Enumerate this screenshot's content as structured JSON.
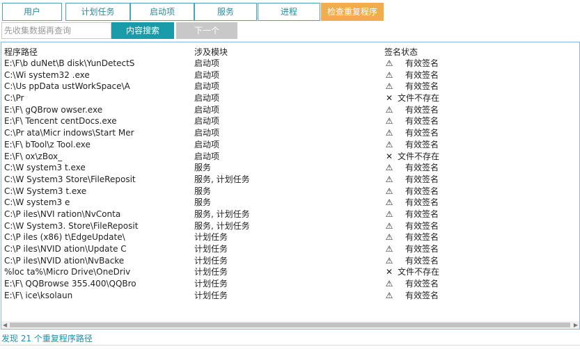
{
  "tabs": [
    {
      "label": "用户"
    },
    {
      "label": "计划任务"
    },
    {
      "label": "启动项"
    },
    {
      "label": "服务"
    },
    {
      "label": "进程"
    },
    {
      "label": "检查重复程序",
      "active": true
    }
  ],
  "toolbar": {
    "search_placeholder": "先收集数据再查询",
    "search_value": "",
    "search_button": "内容搜索",
    "next_button": "下一个"
  },
  "table": {
    "columns": [
      "程序路径",
      "涉及模块",
      "签名状态"
    ],
    "rows": [
      {
        "path": "E:\\F\\b        duNet\\B          disk\\YunDetectS",
        "module": "启动项",
        "sig_icon": "warning-icon",
        "sig": "有效签名"
      },
      {
        "path": "C:\\Wi         system32        .exe",
        "module": "启动项",
        "sig_icon": "warning-icon",
        "sig": "有效签名"
      },
      {
        "path": "C:\\Us        ppData          ustWorkSpace\\A",
        "module": "启动项",
        "sig_icon": "warning-icon",
        "sig": "有效签名"
      },
      {
        "path": "C:\\Pr",
        "module": "启动项",
        "sig_icon": "cross-icon",
        "sig": "文件不存在"
      },
      {
        "path": "E:\\F\\         gQBrow          owser.exe",
        "module": "启动项",
        "sig_icon": "warning-icon",
        "sig": "有效签名"
      },
      {
        "path": "E:\\F\\         Tencent         centDocs.exe",
        "module": "启动项",
        "sig_icon": "warning-icon",
        "sig": "有效签名"
      },
      {
        "path": "C:\\Pr         ata\\Micr        indows\\Start Mer",
        "module": "启动项",
        "sig_icon": "warning-icon",
        "sig": "有效签名"
      },
      {
        "path": "E:\\F\\         bTool\\z         Tool.exe",
        "module": "启动项",
        "sig_icon": "warning-icon",
        "sig": "有效签名"
      },
      {
        "path": "E:\\F\\         ox\\zBox_",
        "module": "启动项",
        "sig_icon": "cross-icon",
        "sig": "文件不存在"
      },
      {
        "path": "C:\\W          system3          t.exe",
        "module": "服务",
        "sig_icon": "warning-icon",
        "sig": "有效签名"
      },
      {
        "path": "C:\\W          System3          Store\\FileReposit",
        "module": "服务, 计划任务",
        "sig_icon": "warning-icon",
        "sig": "有效签名"
      },
      {
        "path": "C:\\W          System3          t.exe",
        "module": "服务",
        "sig_icon": "warning-icon",
        "sig": "有效签名"
      },
      {
        "path": "C:\\W          system3          e",
        "module": "服务",
        "sig_icon": "warning-icon",
        "sig": "有效签名"
      },
      {
        "path": "C:\\P          iles\\NVI         ration\\NvConta",
        "module": "服务, 计划任务",
        "sig_icon": "warning-icon",
        "sig": "有效签名"
      },
      {
        "path": "C:\\W          System3.         Store\\FileReposit",
        "module": "服务, 计划任务",
        "sig_icon": "warning-icon",
        "sig": "有效签名"
      },
      {
        "path": "C:\\P          iles (x86)        t\\EdgeUpdate\\",
        "module": "计划任务",
        "sig_icon": "warning-icon",
        "sig": "有效签名"
      },
      {
        "path": "C:\\P          iles\\NVID        ation\\Update C",
        "module": "计划任务",
        "sig_icon": "warning-icon",
        "sig": "有效签名"
      },
      {
        "path": "C:\\P          iles\\NVID        ation\\NvBacke",
        "module": "计划任务",
        "sig_icon": "warning-icon",
        "sig": "有效签名"
      },
      {
        "path": "%loc          ta%\\Micro        Drive\\OneDriv",
        "module": "计划任务",
        "sig_icon": "cross-icon",
        "sig": "文件不存在"
      },
      {
        "path": "E:\\F\\         QQBrowse         355.400\\QQBro",
        "module": "计划任务",
        "sig_icon": "warning-icon",
        "sig": "有效签名"
      },
      {
        "path": "E:\\F\\         ice\\ksolaun",
        "module": "计划任务",
        "sig_icon": "warning-icon",
        "sig": "有效签名"
      }
    ]
  },
  "status": "发现 21 个重复程序路径"
}
